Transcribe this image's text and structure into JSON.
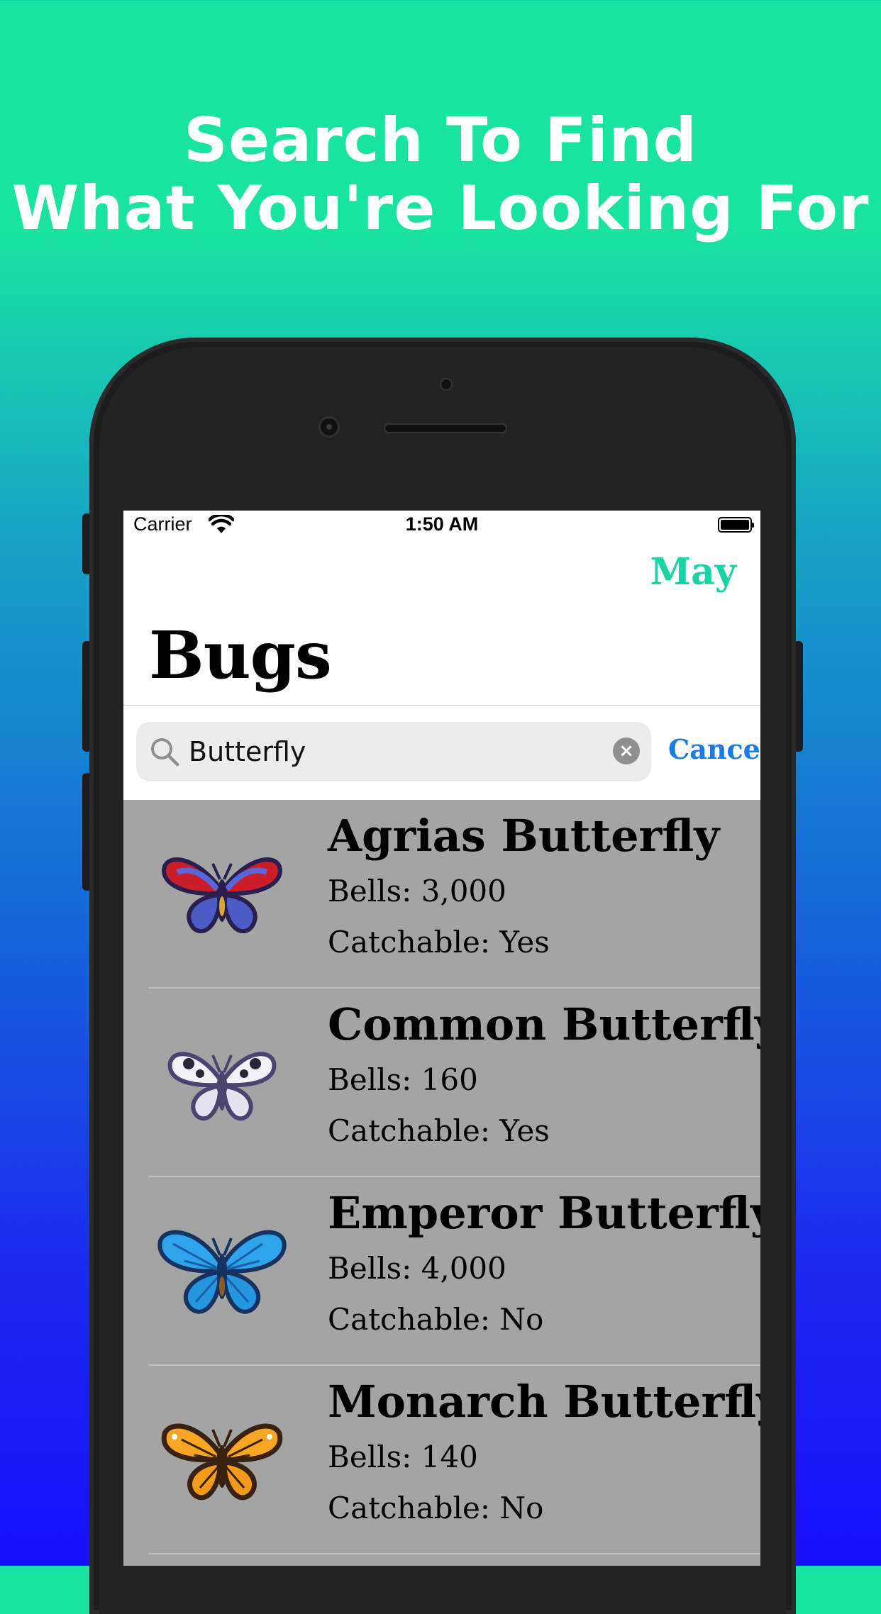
{
  "headline": {
    "line1": "Search To Find",
    "line2": "What You're Looking For"
  },
  "status_bar": {
    "carrier": "Carrier",
    "time": "1:50 AM"
  },
  "nav": {
    "month_button": "May",
    "title": "Bugs"
  },
  "search": {
    "value": "Butterfly",
    "cancel_label": "Cancel"
  },
  "colors": {
    "accent": "#19d3a6",
    "link": "#1a7be8",
    "list_bg": "#a4a4a4"
  },
  "results": [
    {
      "name": "Agrias Butterfly",
      "bells": "Bells: 3,000",
      "catchable": "Catchable: Yes",
      "icon": "agrias-butterfly-icon"
    },
    {
      "name": "Common Butterfly",
      "bells": "Bells: 160",
      "catchable": "Catchable: Yes",
      "icon": "common-butterfly-icon"
    },
    {
      "name": "Emperor Butterfly",
      "bells": "Bells: 4,000",
      "catchable": "Catchable: No",
      "icon": "emperor-butterfly-icon"
    },
    {
      "name": "Monarch Butterfly",
      "bells": "Bells: 140",
      "catchable": "Catchable: No",
      "icon": "monarch-butterfly-icon"
    }
  ]
}
